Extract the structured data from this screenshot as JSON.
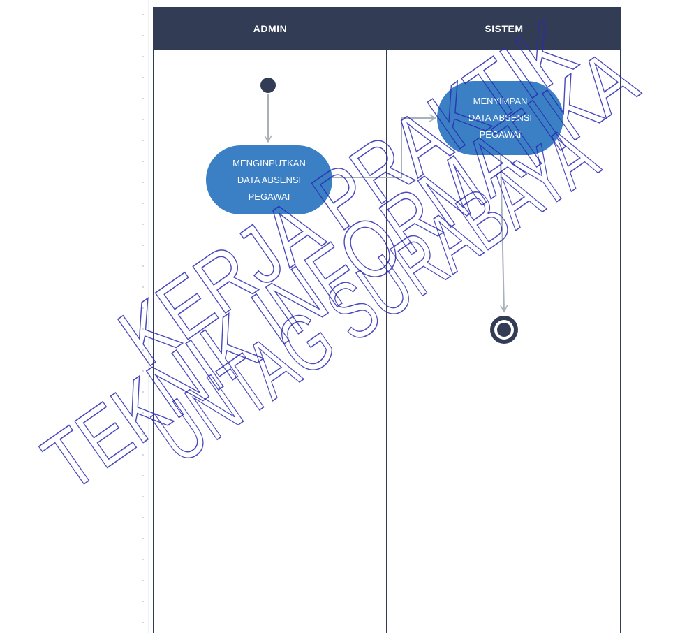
{
  "lanes": {
    "admin": "ADMIN",
    "sistem": "SISTEM"
  },
  "activities": {
    "input": "MENGINPUTKAN\nDATA ABSENSI\nPEGAWAI",
    "save": "MENYIMPAN\nDATA ABSENSI\nPEGAWAI"
  },
  "watermark": {
    "line1": "KERJA PRAKTIK",
    "line2": "TEKNIK INFORMATIKA",
    "line3": "UNTAG SURABAYA"
  },
  "colors": {
    "header": "#333c55",
    "activity": "#3b80c4",
    "node": "#333c55",
    "connector": "#a9b1bb",
    "watermark": "#2a2ab0"
  }
}
